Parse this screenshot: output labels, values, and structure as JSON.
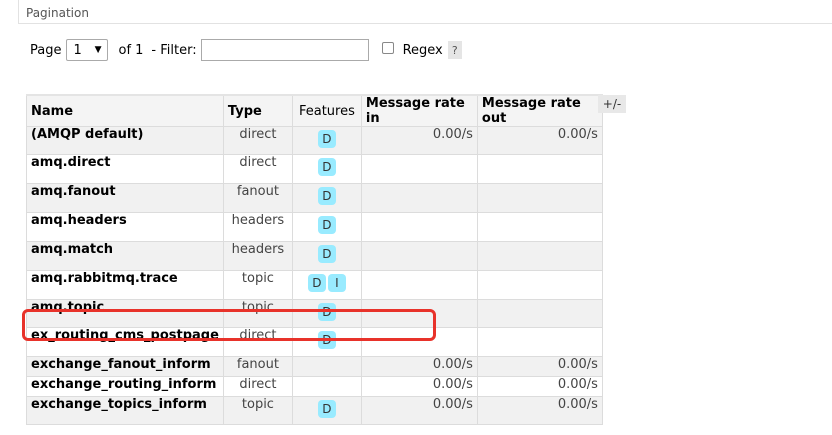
{
  "section": {
    "title": "Pagination"
  },
  "pager": {
    "page_label": "Page",
    "page_value": "1",
    "of_label": "of 1",
    "filter_label": "- Filter:",
    "filter_value": "",
    "regex_label": "Regex",
    "help_label": "?"
  },
  "table": {
    "headers": [
      "Name",
      "Type",
      "Features",
      "Message rate in",
      "Message rate out"
    ],
    "toggle_label": "+/-",
    "rows": [
      {
        "name": "(AMQP default)",
        "type": "direct",
        "features": [
          "D"
        ],
        "rate_in": "0.00/s",
        "rate_out": "0.00/s"
      },
      {
        "name": "amq.direct",
        "type": "direct",
        "features": [
          "D"
        ],
        "rate_in": "",
        "rate_out": ""
      },
      {
        "name": "amq.fanout",
        "type": "fanout",
        "features": [
          "D"
        ],
        "rate_in": "",
        "rate_out": ""
      },
      {
        "name": "amq.headers",
        "type": "headers",
        "features": [
          "D"
        ],
        "rate_in": "",
        "rate_out": ""
      },
      {
        "name": "amq.match",
        "type": "headers",
        "features": [
          "D"
        ],
        "rate_in": "",
        "rate_out": ""
      },
      {
        "name": "amq.rabbitmq.trace",
        "type": "topic",
        "features": [
          "D",
          "I"
        ],
        "rate_in": "",
        "rate_out": ""
      },
      {
        "name": "amq.topic",
        "type": "topic",
        "features": [
          "D"
        ],
        "rate_in": "",
        "rate_out": ""
      },
      {
        "name": "ex_routing_cms_postpage",
        "type": "direct",
        "features": [
          "D"
        ],
        "rate_in": "",
        "rate_out": ""
      },
      {
        "name": "exchange_fanout_inform",
        "type": "fanout",
        "features": [],
        "rate_in": "0.00/s",
        "rate_out": "0.00/s"
      },
      {
        "name": "exchange_routing_inform",
        "type": "direct",
        "features": [],
        "rate_in": "0.00/s",
        "rate_out": "0.00/s"
      },
      {
        "name": "exchange_topics_inform",
        "type": "topic",
        "features": [
          "D"
        ],
        "rate_in": "0.00/s",
        "rate_out": "0.00/s"
      }
    ]
  },
  "colors": {
    "feature_badge": "#99ebff",
    "highlight": "#e8322a"
  }
}
